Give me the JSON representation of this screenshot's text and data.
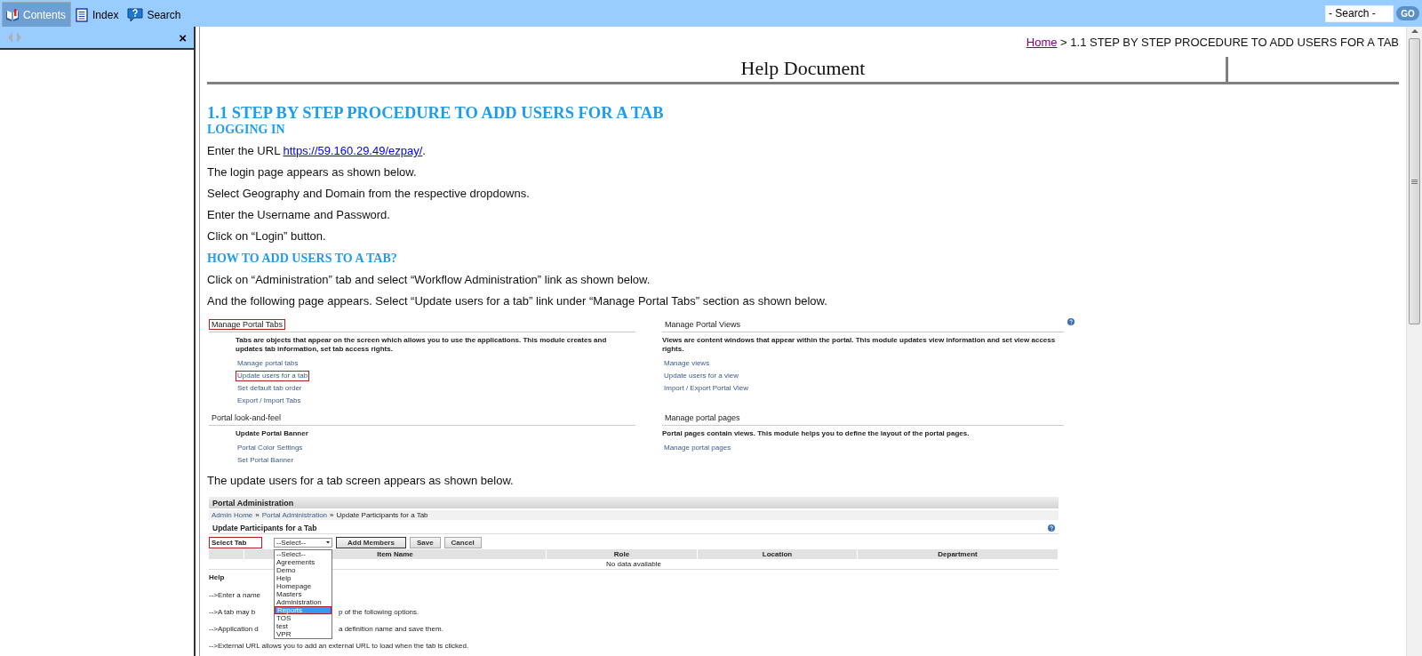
{
  "toolbar": {
    "tabs": [
      {
        "label": "Contents",
        "selected": true
      },
      {
        "label": "Index",
        "selected": false
      },
      {
        "label": "Search",
        "selected": false
      }
    ],
    "search": {
      "placeholder": "- Search -"
    },
    "go_button": "GO"
  },
  "nav_pane": {
    "close": "×"
  },
  "document": {
    "breadcrumb": {
      "home": "Home",
      "separator": ">",
      "current": "1.1 STEP BY STEP PROCEDURE TO ADD USERS FOR A TAB"
    },
    "banner_title": "Help Document",
    "blocks": [
      {
        "kind": "heading",
        "text": "1.1 STEP BY STEP PROCEDURE TO ADD USERS FOR A TAB"
      },
      {
        "kind": "subheading",
        "text": "LOGGING IN"
      },
      {
        "kind": "paragraph",
        "text": "Enter the URL ",
        "link": "https://59.160.29.49/ezpay/",
        "after": "."
      },
      {
        "kind": "paragraph",
        "text": "The login page appears as shown below."
      },
      {
        "kind": "paragraph",
        "text": "Select Geography and Domain from the respective dropdowns."
      },
      {
        "kind": "paragraph",
        "text": "Enter the Username and Password."
      },
      {
        "kind": "paragraph",
        "text": "Click on “Login” button."
      },
      {
        "kind": "subheading",
        "text": "HOW TO ADD USERS TO A TAB?"
      },
      {
        "kind": "paragraph",
        "text": "Click on “Administration” tab and select “Workflow Administration” link as shown below."
      },
      {
        "kind": "paragraph",
        "text": "And the following page appears. Select “Update users for a tab” link under “Manage Portal Tabs” section as shown below."
      },
      {
        "kind": "modules_screenshot",
        "sections": [
          {
            "title": "Manage Portal Tabs",
            "highlighted": true,
            "description": "Tabs are objects that appear on the screen which allows you to use the applications. This module creates and updates tab information, set tab access rights.",
            "links": [
              {
                "label": "Manage portal tabs",
                "highlighted": false
              },
              {
                "label": "Update users for a tab",
                "highlighted": true
              },
              {
                "label": "Set default tab order",
                "highlighted": false
              },
              {
                "label": "Export / Import Tabs",
                "highlighted": false
              }
            ]
          },
          {
            "title": "Manage Portal Views",
            "highlighted": false,
            "description": "Views are content windows that appear within the portal. This module updates view information and set view access rights.",
            "links": [
              {
                "label": "Manage views",
                "highlighted": false
              },
              {
                "label": "Update users for a view",
                "highlighted": false
              },
              {
                "label": "Import / Export Portal View",
                "highlighted": false
              }
            ]
          },
          {
            "title": "Portal look-and-feel",
            "highlighted": false,
            "description": "Update Portal Banner",
            "links": [
              {
                "label": "Portal Color Settings",
                "highlighted": false
              },
              {
                "label": "Set Portal Banner",
                "highlighted": false
              }
            ]
          },
          {
            "title": "Manage portal pages",
            "highlighted": false,
            "description": "Portal pages contain views. This module helps you to define the layout of the portal pages.",
            "links": [
              {
                "label": "Manage portal pages",
                "highlighted": false
              }
            ]
          }
        ]
      },
      {
        "kind": "paragraph",
        "text": "The update users for a tab screen appears as shown below."
      },
      {
        "kind": "admin_screenshot",
        "header": "Portal Administration",
        "breadcrumb": [
          "Admin Home",
          "Portal Administration",
          "Update Participants for a Tab"
        ],
        "breadcrumb_separator": "»",
        "title": "Update Participants for a Tab",
        "select_label": "Select Tab",
        "select_value": "--Select--",
        "buttons": [
          "Add Members",
          "Save",
          "Cancel"
        ],
        "columns": [
          "Item Name",
          "Role",
          "Location",
          "Department"
        ],
        "empty_text": "No data available",
        "help_title": "Help",
        "help_lines": [
          {
            "text": "-->Enter a name"
          },
          {
            "text": "-->A tab may b",
            "continuation": "p of the following options."
          },
          {
            "text": "-->Application d",
            "continuation": "a definition name and save them."
          },
          {
            "text": "-->External URL allows you to add an external URL to load when the tab is clicked."
          }
        ],
        "dropdown_options": [
          {
            "label": "--Select--",
            "selected": false
          },
          {
            "label": "Agreements",
            "selected": false
          },
          {
            "label": "Demo",
            "selected": false
          },
          {
            "label": "Help",
            "selected": false
          },
          {
            "label": "Homepage",
            "selected": false
          },
          {
            "label": "Masters",
            "selected": false
          },
          {
            "label": "Administration",
            "selected": false
          },
          {
            "label": "Reports",
            "selected": true
          },
          {
            "label": "TOS",
            "selected": false
          },
          {
            "label": "test",
            "selected": false
          },
          {
            "label": "VPR",
            "selected": false
          }
        ]
      }
    ]
  }
}
